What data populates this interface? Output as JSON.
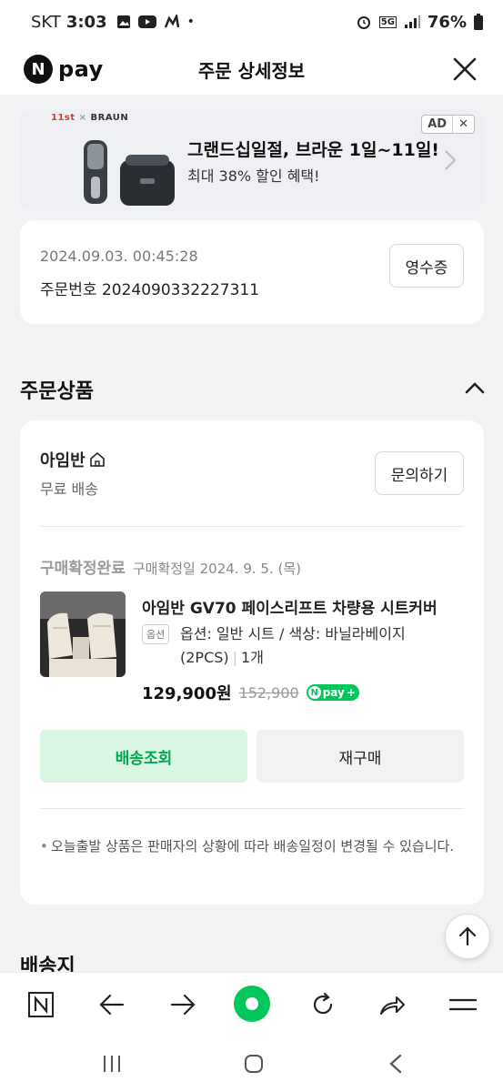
{
  "status_bar": {
    "carrier": "SKT",
    "time": "3:03",
    "battery": "76%",
    "network": "5G"
  },
  "app_bar": {
    "logo_letter": "N",
    "logo_text": "pay",
    "title": "주문 상세정보"
  },
  "ad": {
    "brand_a": "11st",
    "brand_b": "BRAUN",
    "headline": "그랜드십일절, 브라운 1일~11일!",
    "subtext": "최대 38% 할인 혜택!",
    "ad_label": "AD",
    "close_label": "✕"
  },
  "order": {
    "datetime": "2024.09.03. 00:45:28",
    "number_label": "주문번호",
    "number": "2024090332227311",
    "receipt_button": "영수증"
  },
  "products_section": {
    "title": "주문상품"
  },
  "product_card": {
    "seller": "아임반",
    "shipping": "무료 배송",
    "inquiry_button": "문의하기",
    "status": "구매확정완료",
    "status_date": "구매확정일 2024. 9. 5. (목)",
    "name": "아임반 GV70 페이스리프트 차량용 시트커버",
    "option_tag": "옵션",
    "option": "옵션: 일반 시트 / 색상: 바닐라베이지(2PCS)",
    "quantity": "1개",
    "price": "129,900원",
    "original_price": "152,900",
    "npay_badge": "pay",
    "track_button": "배송조회",
    "rebuy_button": "재구매",
    "note": "오늘출발 상품은 판매자의 상황에 따라 배송일정이 변경될 수 있습니다."
  },
  "next_section": {
    "title": "배송지"
  },
  "colors": {
    "naver_green": "#03c75a",
    "track_bg": "#d9f7e3",
    "track_text": "#00a94f"
  },
  "toolbar_icons": [
    "n-icon",
    "back-arrow-icon",
    "forward-arrow-icon",
    "home-dot-icon",
    "refresh-icon",
    "share-icon",
    "menu-icon"
  ],
  "nav_icons": [
    "recents-icon",
    "home-icon",
    "back-icon"
  ]
}
